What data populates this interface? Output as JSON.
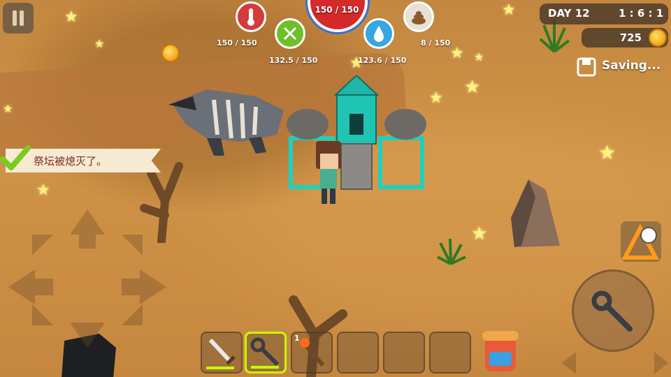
{
  "hud": {
    "health": "150 / 150",
    "temperature": "150 / 150",
    "hunger": "132.5 / 150",
    "thirst": "123.6 / 150",
    "waste": "8 / 150"
  },
  "day": {
    "label": "DAY 12",
    "time": "1 : 6 : 1"
  },
  "coins": "725",
  "saving": "Saving...",
  "quest": "祭坛被熄灭了。",
  "hotbar": {
    "torch_count": "1"
  },
  "colors": {
    "health": "#d42a2a",
    "hunger": "#6fbf2a",
    "thirst": "#35a8e0",
    "temperature": "#d63a3a",
    "waste": "#8a5a2b",
    "selected_slot": "#c6ff00"
  },
  "icons": [
    "pause-icon",
    "thermometer-icon",
    "fork-knife-icon",
    "water-drop-icon",
    "poop-icon",
    "coin-icon",
    "save-icon",
    "checkmark-icon",
    "sword-icon",
    "wrench-icon",
    "torch-icon",
    "backpack-icon",
    "compass-map-icon"
  ]
}
